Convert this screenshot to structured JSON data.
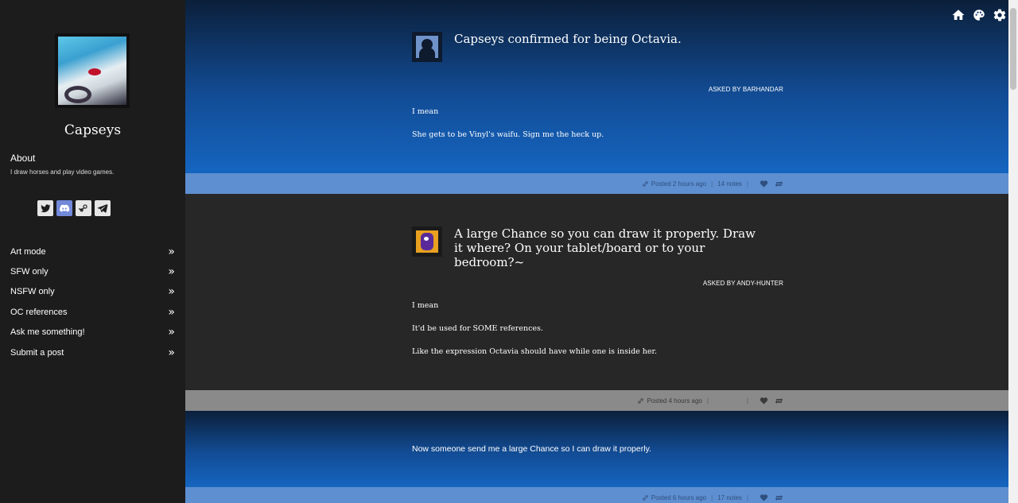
{
  "blog": {
    "title": "Capseys",
    "about_title": "About",
    "about_text": "I draw horses and play video games."
  },
  "socials": [
    {
      "icon": "twitter-icon"
    },
    {
      "icon": "discord-icon"
    },
    {
      "icon": "steam-icon"
    },
    {
      "icon": "telegram-icon"
    }
  ],
  "nav": [
    {
      "label": "Art mode"
    },
    {
      "label": "SFW only"
    },
    {
      "label": "NSFW only"
    },
    {
      "label": "OC references"
    },
    {
      "label": "Ask me something!"
    },
    {
      "label": "Submit a post"
    }
  ],
  "top_icons": [
    "home-icon",
    "palette-icon",
    "gear-icon"
  ],
  "posts": [
    {
      "question": "Capseys confirmed for being Octavia.",
      "asked_by": "ASKED BY BARHANDAR",
      "answer": [
        "I mean",
        "She gets to be Vinyl's waifu. Sign me the heck up."
      ],
      "posted": "Posted 2 hours ago",
      "notes": "14 notes"
    },
    {
      "question": "A large Chance so you can draw it properly. Draw it where? On your tablet/board or to your bedroom?~",
      "asked_by": "ASKED BY ANDY-HUNTER",
      "answer": [
        "I mean",
        "It'd be used for SOME references.",
        "Like the expression Octavia should have while one is inside her."
      ],
      "posted": "Posted 4 hours ago",
      "notes": ""
    },
    {
      "text": "Now someone send me a large Chance so I can draw it properly.",
      "posted": "Posted 6 hours ago",
      "notes": "17 notes"
    }
  ]
}
